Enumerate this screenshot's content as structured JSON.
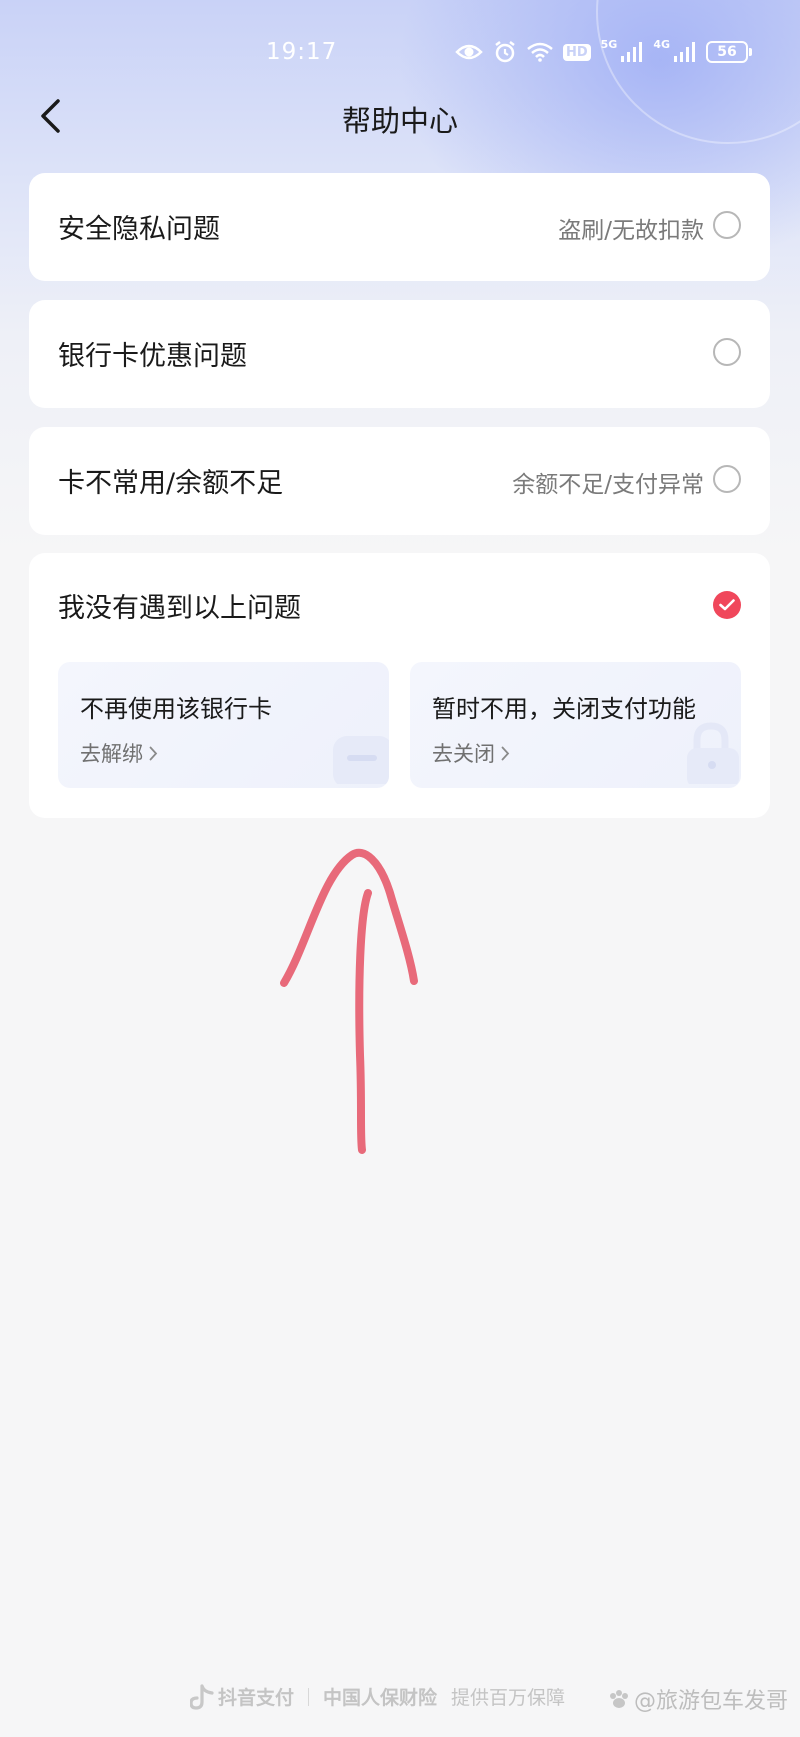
{
  "status_bar": {
    "time": "19:17",
    "hd_label": "HD",
    "network_1": "5G",
    "network_2": "4G",
    "battery": "56"
  },
  "header": {
    "title": "帮助中心"
  },
  "options": [
    {
      "label": "安全隐私问题",
      "hint": "盗刷/无故扣款",
      "selected": false
    },
    {
      "label": "银行卡优惠问题",
      "hint": "",
      "selected": false
    },
    {
      "label": "卡不常用/余额不足",
      "hint": "余额不足/支付异常",
      "selected": false
    },
    {
      "label": "我没有遇到以上问题",
      "hint": "",
      "selected": true
    }
  ],
  "sub_options": [
    {
      "title": "不再使用该银行卡",
      "action": "去解绑"
    },
    {
      "title": "暂时不用，关闭支付功能",
      "action": "去关闭"
    }
  ],
  "footer": {
    "brand": "抖音支付",
    "partner": "中国人保财险",
    "tagline": "提供百万保障"
  },
  "watermark": "@旅游包车发哥",
  "colors": {
    "accent": "#f0475b",
    "annotation": "#e86a7a",
    "header_gradient": "#c9d2f7"
  }
}
